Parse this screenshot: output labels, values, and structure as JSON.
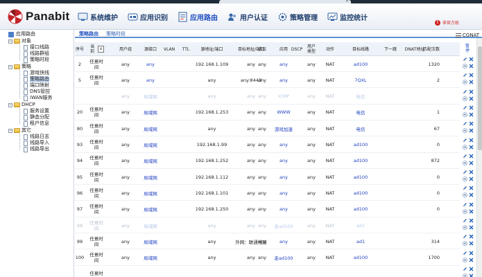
{
  "browser": {
    "tab_title": ""
  },
  "app": {
    "logo_text": "Panabit",
    "nav": [
      {
        "label": "系统维护",
        "icon": "system-maintenance-icon"
      },
      {
        "label": "应用识别",
        "icon": "app-identify-icon"
      },
      {
        "label": "应用路由",
        "icon": "app-routing-icon",
        "active": true
      },
      {
        "label": "用户认证",
        "icon": "user-auth-icon"
      },
      {
        "label": "策略管理",
        "icon": "policy-manage-icon"
      },
      {
        "label": "监控统计",
        "icon": "monitor-stats-icon"
      }
    ],
    "notice": "非官方机"
  },
  "sidebar": {
    "root": "应用路由",
    "groups": [
      {
        "label": "对象",
        "items": [
          "接口线路",
          "线路群组",
          "策略时段"
        ]
      },
      {
        "label": "策略",
        "items": [
          "游戏快线",
          "策略路由",
          "端口映射",
          "DNS管控",
          "iWAN服务"
        ],
        "selected": "策略路由"
      },
      {
        "label": "DHCP",
        "items": [
          "服务设置",
          "静态分配",
          "租户信息"
        ]
      },
      {
        "label": "其它",
        "items": [
          "线路日志",
          "线路导入",
          "线路导出"
        ]
      }
    ]
  },
  "main": {
    "tabs": [
      "策略路由",
      "策略时段"
    ],
    "right_label": "CGNAT",
    "headers": [
      "序号",
      "当前",
      "用户组",
      "源接口",
      "VLAN",
      "TTL",
      "源地址/端口",
      "目标地址/端口",
      "协议",
      "应用",
      "DSCP",
      "用户类型",
      "动作",
      "目标线路",
      "下一跳",
      "DNAT地址",
      "匹配次数",
      "暂停"
    ],
    "condition_select": "∨",
    "rows": [
      {
        "seq": "2",
        "time": "任意时间",
        "group": "any",
        "iface": "any",
        "vlan": "",
        "ttl": "",
        "src": "192.168.1.109",
        "dst": "any",
        "proto": "any",
        "app": "any",
        "dscp": "",
        "utype": "any",
        "action": "NAT",
        "line": "ad100",
        "next": "",
        "dnat": "",
        "hits": "1320",
        "disabled": false
      },
      {
        "seq": "5",
        "time": "任意时间",
        "group": "any",
        "iface": "any",
        "vlan": "",
        "ttl": "",
        "src": "any",
        "dst": "any:8443",
        "proto": "any",
        "app": "any",
        "dscp": "",
        "utype": "any",
        "action": "NAT",
        "line": "7QXL",
        "next": "",
        "dnat": "",
        "hits": "2",
        "disabled": false
      },
      {
        "seq": "",
        "time": "",
        "group": "any",
        "iface": "局域网",
        "vlan": "",
        "ttl": "",
        "src": "any",
        "dst": "any",
        "proto": "any",
        "app": "ICMP",
        "dscp": "",
        "utype": "any",
        "action": "NAT",
        "line": "电信",
        "next": "",
        "dnat": "",
        "hits": "",
        "disabled": true
      },
      {
        "seq": "20",
        "time": "任意时间",
        "group": "any",
        "iface": "局域网",
        "vlan": "",
        "ttl": "",
        "src": "192.168.1.253",
        "dst": "any",
        "proto": "any",
        "app": "WWW",
        "dscp": "",
        "utype": "any",
        "action": "NAT",
        "line": "电信",
        "next": "",
        "dnat": "",
        "hits": "1",
        "disabled": false
      },
      {
        "seq": "80",
        "time": "任意时间",
        "group": "any",
        "iface": "局域网",
        "vlan": "",
        "ttl": "",
        "src": "any",
        "dst": "any",
        "proto": "any",
        "app": "游戏加速",
        "dscp": "",
        "utype": "any",
        "action": "NAT",
        "line": "电信",
        "next": "",
        "dnat": "",
        "hits": "67",
        "disabled": false
      },
      {
        "seq": "93",
        "time": "任意时间",
        "group": "any",
        "iface": "局域网",
        "vlan": "",
        "ttl": "",
        "src": "192.168.1.99",
        "dst": "any",
        "proto": "any",
        "app": "any",
        "dscp": "",
        "utype": "any",
        "action": "NAT",
        "line": "ad100",
        "next": "",
        "dnat": "",
        "hits": "0",
        "disabled": false
      },
      {
        "seq": "94",
        "time": "任意时间",
        "group": "any",
        "iface": "局域网",
        "vlan": "",
        "ttl": "",
        "src": "192.168.1.252",
        "dst": "any",
        "proto": "any",
        "app": "any",
        "dscp": "",
        "utype": "any",
        "action": "NAT",
        "line": "ad100",
        "next": "",
        "dnat": "",
        "hits": "872",
        "disabled": false
      },
      {
        "seq": "95",
        "time": "任意时间",
        "group": "any",
        "iface": "局域网",
        "vlan": "",
        "ttl": "",
        "src": "192.168.1.112",
        "dst": "any",
        "proto": "any",
        "app": "any",
        "dscp": "",
        "utype": "any",
        "action": "NAT",
        "line": "ad100",
        "next": "",
        "dnat": "",
        "hits": "0",
        "disabled": false
      },
      {
        "seq": "96",
        "time": "任意时间",
        "group": "any",
        "iface": "局域网",
        "vlan": "",
        "ttl": "",
        "src": "192.168.1.101",
        "dst": "any",
        "proto": "any",
        "app": "any",
        "dscp": "",
        "utype": "any",
        "action": "NAT",
        "line": "ad100",
        "next": "",
        "dnat": "",
        "hits": "0",
        "disabled": false
      },
      {
        "seq": "97",
        "time": "任意时间",
        "group": "any",
        "iface": "局域网",
        "vlan": "",
        "ttl": "",
        "src": "192.168.1.250",
        "dst": "any",
        "proto": "any",
        "app": "any",
        "dscp": "",
        "utype": "any",
        "action": "NAT",
        "line": "ad100",
        "next": "",
        "dnat": "",
        "hits": "0",
        "disabled": false
      },
      {
        "seq": "98",
        "time": "任意时间",
        "group": "any",
        "iface": "局域网",
        "vlan": "",
        "ttl": "",
        "src": "any",
        "dst": "any",
        "proto": "any",
        "app": "走ad100",
        "dscp": "",
        "utype": "any",
        "action": "NAT",
        "line": "ad1",
        "next": "",
        "dnat": "",
        "hits": "",
        "disabled": true
      },
      {
        "seq": "99",
        "time": "任意时间",
        "group": "any",
        "iface": "局域网",
        "vlan": "",
        "ttl": "",
        "src": "any",
        "dst": "外网：联通线路",
        "proto": "any",
        "app": "any",
        "dscp": "",
        "utype": "any",
        "action": "NAT",
        "line": "ad1",
        "next": "",
        "dnat": "",
        "hits": "314",
        "disabled": false
      },
      {
        "seq": "100",
        "time": "任意时间",
        "group": "any",
        "iface": "局域网",
        "vlan": "",
        "ttl": "",
        "src": "any",
        "dst": "any",
        "proto": "any",
        "app": "走ad100",
        "dscp": "",
        "utype": "any",
        "action": "NAT",
        "line": "ad100",
        "next": "",
        "dnat": "",
        "hits": "1700",
        "disabled": false
      },
      {
        "seq": "",
        "time": "任意时",
        "group": "",
        "iface": "",
        "vlan": "",
        "ttl": "",
        "src": "",
        "dst": "",
        "proto": "",
        "app": "",
        "dscp": "",
        "utype": "",
        "action": "",
        "line": "",
        "next": "",
        "dnat": "",
        "hits": "",
        "disabled": false
      }
    ]
  },
  "colors": {
    "accent": "#1f4fbf",
    "link": "#1f3fc0",
    "header_bg": "#eef3f9"
  }
}
